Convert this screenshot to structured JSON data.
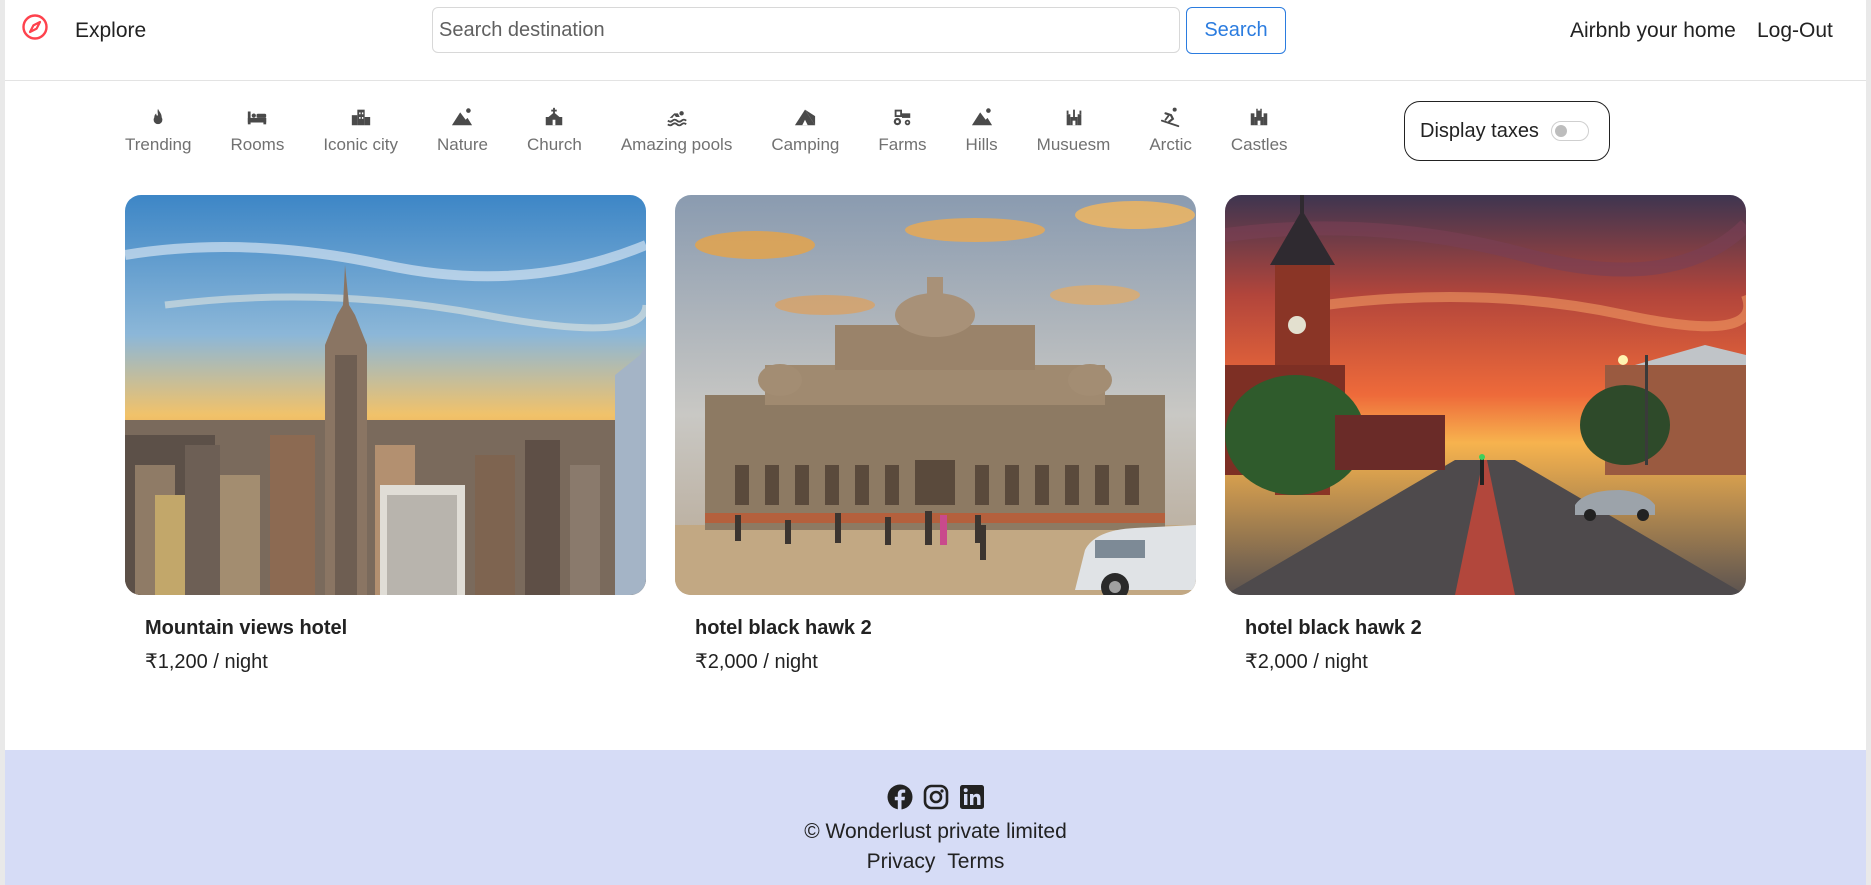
{
  "navbar": {
    "brand_icon": "compass-icon",
    "explore_label": "Explore",
    "search": {
      "value": "",
      "placeholder": "Search destination"
    },
    "search_button_label": "Search",
    "host_label": "Airbnb your home",
    "logout_label": "Log-Out",
    "accent_color": "#fe424d",
    "search_button_color": "#2b7cdf"
  },
  "filters": [
    {
      "label": "Trending",
      "icon": "fire-icon"
    },
    {
      "label": "Rooms",
      "icon": "bed-icon"
    },
    {
      "label": "Iconic city",
      "icon": "city-icon"
    },
    {
      "label": "Nature",
      "icon": "mountain-sun-icon"
    },
    {
      "label": "Church",
      "icon": "church-icon"
    },
    {
      "label": "Amazing pools",
      "icon": "swimmer-icon"
    },
    {
      "label": "Camping",
      "icon": "campground-icon"
    },
    {
      "label": "Farms",
      "icon": "tractor-icon"
    },
    {
      "label": "Hills",
      "icon": "mountain-sun-icon"
    },
    {
      "label": "Musuesm",
      "icon": "museum-icon"
    },
    {
      "label": "Arctic",
      "icon": "skier-icon"
    },
    {
      "label": "Castles",
      "icon": "castle-icon"
    }
  ],
  "tax_toggle": {
    "label": "Display taxes",
    "enabled": false
  },
  "listings": [
    {
      "title": "Mountain views hotel",
      "price": "₹1,200 / night"
    },
    {
      "title": "hotel black hawk 2",
      "price": "₹2,000 / night"
    },
    {
      "title": "hotel black hawk 2",
      "price": "₹2,000 / night"
    }
  ],
  "footer": {
    "socials": [
      "facebook-icon",
      "instagram-icon",
      "linkedin-icon"
    ],
    "copyright": "© Wonderlust private limited",
    "links": [
      "Privacy",
      "Terms"
    ],
    "background_color": "#d6dcf6"
  }
}
